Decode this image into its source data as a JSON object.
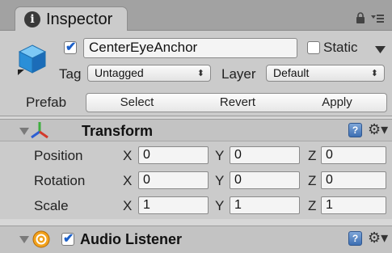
{
  "window": {
    "tab_label": "Inspector",
    "tab_icon": "info-icon"
  },
  "gameobject": {
    "active": true,
    "name": "CenterEyeAnchor",
    "static_label": "Static",
    "static_checked": false,
    "tag_label": "Tag",
    "tag_value": "Untagged",
    "layer_label": "Layer",
    "layer_value": "Default",
    "prefab_label": "Prefab",
    "buttons": {
      "select": "Select",
      "revert": "Revert",
      "apply": "Apply"
    }
  },
  "transform": {
    "title": "Transform",
    "axis_labels": {
      "x": "X",
      "y": "Y",
      "z": "Z"
    },
    "rows": [
      {
        "label": "Position",
        "x": "0",
        "y": "0",
        "z": "0"
      },
      {
        "label": "Rotation",
        "x": "0",
        "y": "0",
        "z": "0"
      },
      {
        "label": "Scale",
        "x": "1",
        "y": "1",
        "z": "1"
      }
    ]
  },
  "audio_listener": {
    "title": "Audio Listener",
    "enabled": true
  },
  "colors": {
    "panel": "#cbcbcb",
    "tabbar": "#a2a2a2",
    "component_header": "#c3c3c3",
    "check": "#1b5fc8",
    "cube": "#2a8fd8"
  }
}
